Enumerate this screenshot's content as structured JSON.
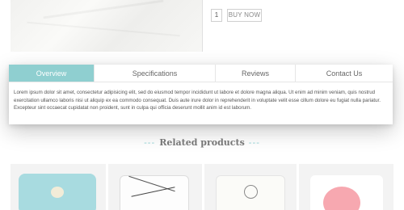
{
  "purchase": {
    "quantity": "1",
    "buy_label": "BUY NOW"
  },
  "tabs": {
    "items": [
      {
        "label": "Overview"
      },
      {
        "label": "Specifications"
      },
      {
        "label": "Reviews"
      },
      {
        "label": "Contact Us"
      }
    ],
    "active_index": 0,
    "active_color": "#8fcfd0",
    "overview_text": "Lorem ipsum dolor sit amet, consectetur adipisicing elit, sed do eiusmod tempor incididunt ut labore et dolore magna aliqua. Ut enim ad minim veniam, quis nostrud exercitation ullamco laboris nisi ut aliquip ex ea commodo consequat. Duis aute irure dolor in reprehenderit in voluptate velit esse cillum dolore eu fugiat nulla pariatur. Excepteur sint occaecat cupidatat non proident, sunt in culpa qui officia deserunt mollit anim id est laborum."
  },
  "related": {
    "title": "Related products",
    "dash_left": "---",
    "dash_right": "---",
    "products": [
      {
        "image": "light-blue-pillow"
      },
      {
        "image": "marble-pillow"
      },
      {
        "image": "dreamcatcher-pillow"
      },
      {
        "image": "pink-dot-pillow"
      }
    ]
  }
}
